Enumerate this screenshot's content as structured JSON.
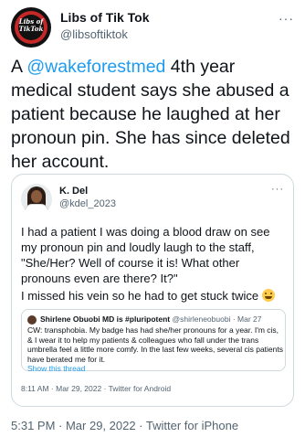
{
  "author": {
    "name": "Libs of Tik Tok",
    "handle": "@libsoftiktok",
    "avatar_text_line1": "Libs of",
    "avatar_text_line2": "TikTok",
    "more": "···"
  },
  "tweet": {
    "text_prefix": "A ",
    "mention": "@wakeforestmed",
    "text_rest": " 4th year medical student says she abused a patient because he laughed at her pronoun pin. She has since deleted her account."
  },
  "quote": {
    "name": "K. Del",
    "handle": "@kdel_2023",
    "more": "···",
    "paragraph1": "I had a patient I was doing a blood draw on see my pronoun pin and loudly laugh to the staff, \"She/Her? Well of course it is! What other pronouns even are there? It?\"",
    "paragraph2": "I missed his vein so he had to get stuck twice",
    "emoji": "grimacing-face",
    "nested": {
      "name": "Shirlene Obuobi MD is #pluripotent",
      "handle": "@shirleneobuobi",
      "date": "· Mar 27",
      "text": "CW: transphobia. My badge has had she/her pronouns for a year. I'm cis, & I wear it to help  my patients & colleagues who fall under the trans umbrella feel a little more comfy. In the last few weeks, several cis patients have berated me for it.",
      "show_thread": "Show this thread"
    },
    "timestamp": "8:11 AM · Mar 29, 2022 · Twitter for Android"
  },
  "footer": {
    "timestamp": "5:31 PM · Mar 29, 2022 · Twitter for iPhone"
  },
  "colors": {
    "link": "#1d9bf0",
    "secondary_text": "#536471",
    "border": "#cfd9de"
  }
}
